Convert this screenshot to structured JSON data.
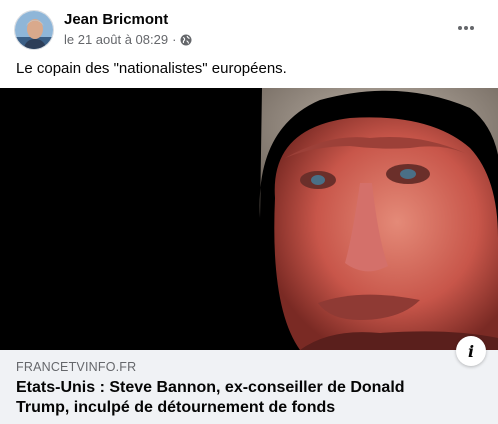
{
  "post": {
    "author": "Jean Bricmont",
    "timestamp": "le 21 août à 08:29",
    "separator": "·",
    "privacy_icon": "globe-icon",
    "more_icon": "more-options-icon",
    "caption": "Le copain des \"nationalistes\" européens."
  },
  "link_preview": {
    "domain": "FRANCETVINFO.FR",
    "headline": "Etats-Unis : Steve Bannon, ex-conseiller de Donald Trump, inculpé de détournement de fonds",
    "info_label": "i"
  },
  "colors": {
    "text_primary": "#050505",
    "text_secondary": "#65676b",
    "footer_bg": "#f0f2f5",
    "photo_bg": "#000000"
  }
}
